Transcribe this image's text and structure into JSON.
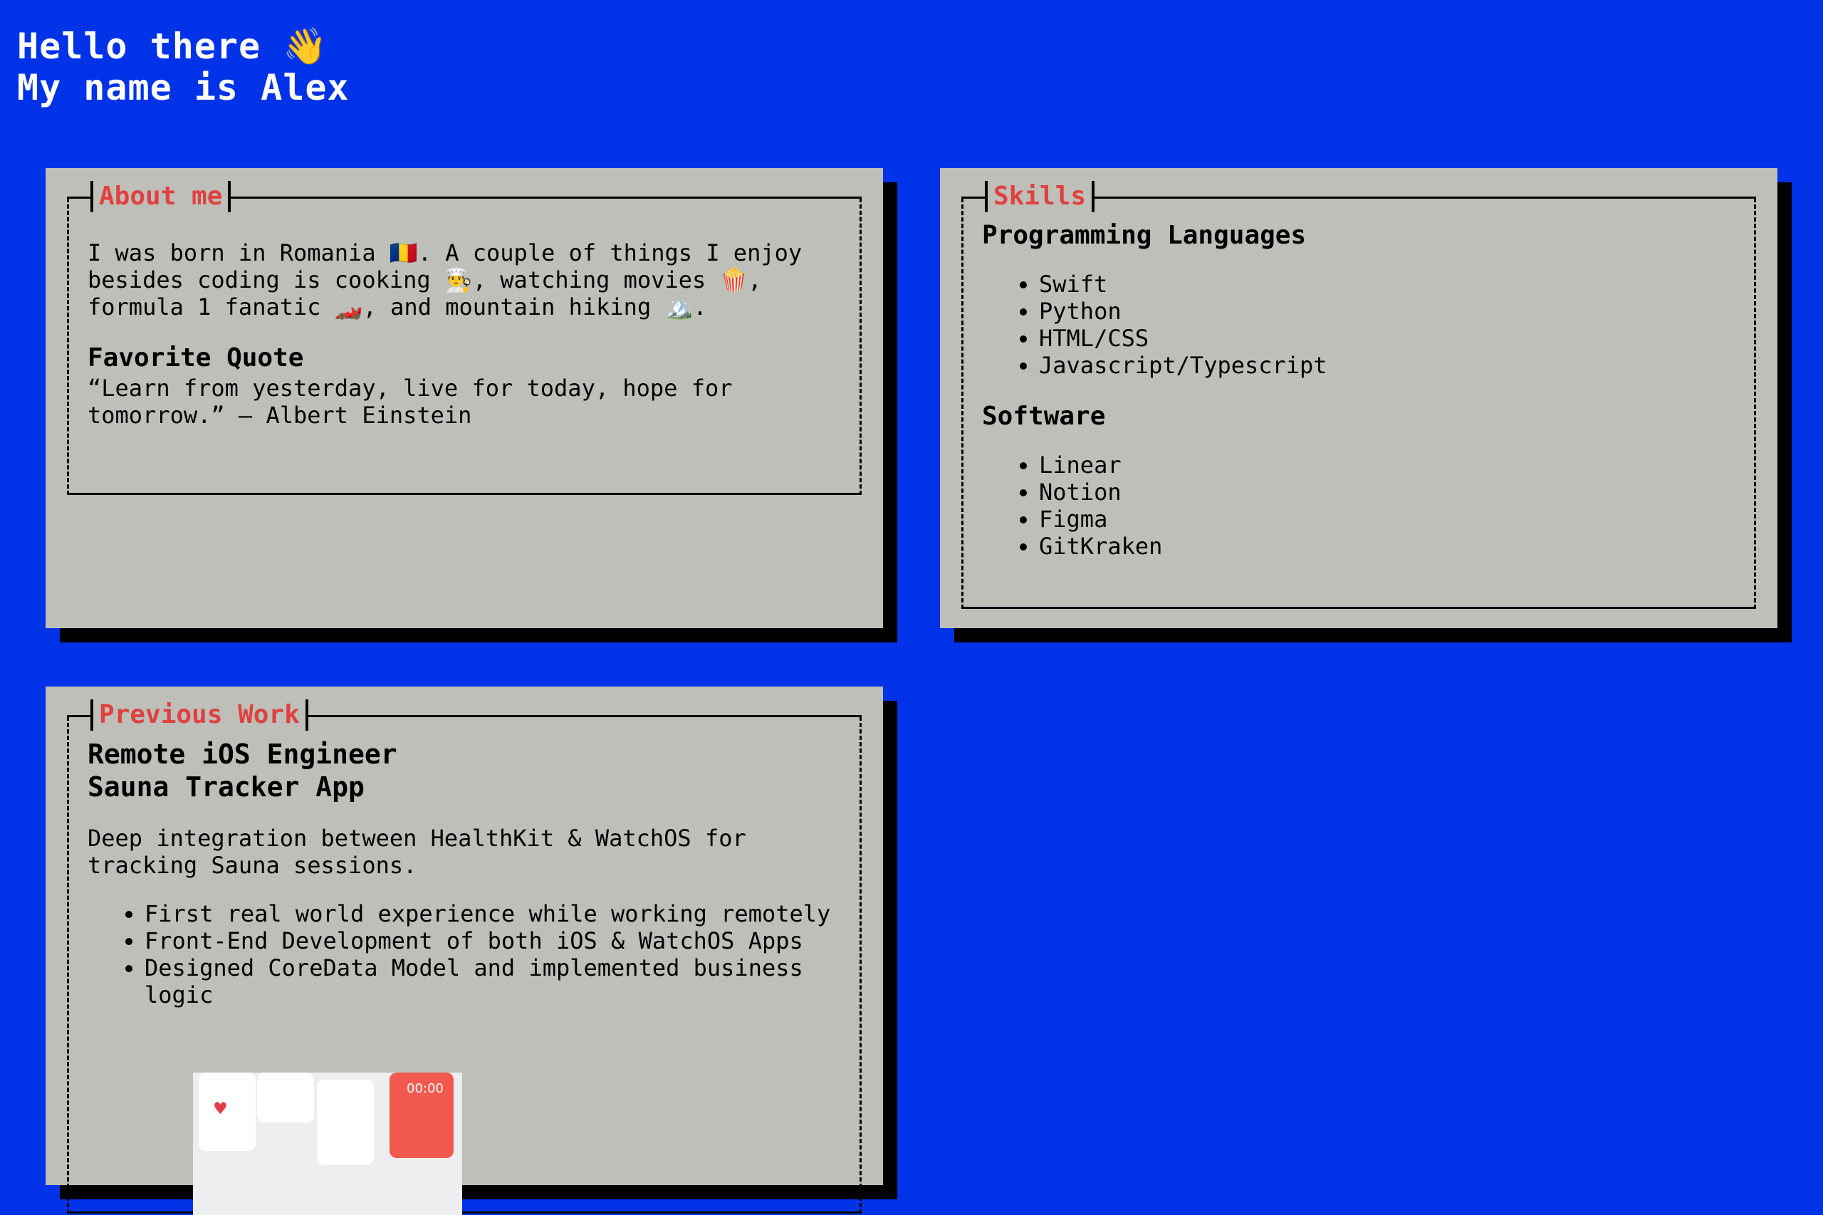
{
  "greeting": {
    "line1": "Hello there 👋",
    "line2": "My name is Alex"
  },
  "about": {
    "title": "About me",
    "text": "I was born in Romania 🇷🇴. A couple of things I enjoy besides coding is cooking 👨‍🍳, watching movies 🍿, formula 1 fanatic 🏎️, and mountain hiking 🏔️.",
    "quote_heading": "Favorite Quote",
    "quote": "“Learn from yesterday, live for today, hope for tomorrow.” – Albert Einstein"
  },
  "skills": {
    "title": "Skills",
    "languages_heading": "Programming Languages",
    "languages": [
      "Swift",
      "Python",
      "HTML/CSS",
      "Javascript/Typescript"
    ],
    "software_heading": "Software",
    "software": [
      "Linear",
      "Notion",
      "Figma",
      "GitKraken"
    ]
  },
  "work": {
    "title": "Previous Work",
    "role": "Remote iOS Engineer",
    "project": "Sauna Tracker App",
    "description": "Deep integration between HealthKit & WatchOS for tracking Sauna sessions.",
    "bullets": [
      "First real world experience while working remotely",
      "Front-End Development of both iOS & WatchOS Apps",
      "Designed CoreData Model and implemented business logic"
    ],
    "screenshot_timer": "00:00"
  },
  "colors": {
    "background": "#0033e8",
    "card": "#bdbfb8",
    "title_accent": "#e04040"
  }
}
